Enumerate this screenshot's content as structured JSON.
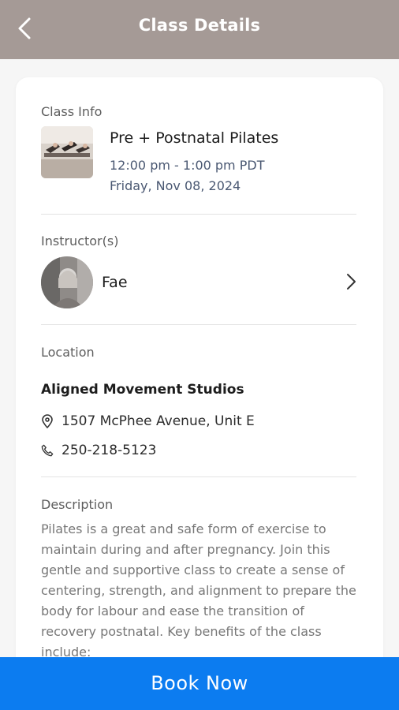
{
  "header": {
    "title": "Class Details"
  },
  "class_info": {
    "section_label": "Class Info",
    "name": "Pre + Postnatal Pilates",
    "time": "12:00 pm - 1:00 pm PDT",
    "date": "Friday, Nov 08, 2024"
  },
  "instructor": {
    "section_label": "Instructor(s)",
    "name": "Fae"
  },
  "location": {
    "section_label": "Location",
    "name": "Aligned Movement Studios",
    "address": "1507 McPhee Avenue, Unit E",
    "phone": "250-218-5123"
  },
  "description": {
    "section_label": "Description",
    "text": "Pilates is a great and safe form of exercise to maintain during and after pregnancy. Join this gentle and supportive class to create a sense of centering, strength, and alignment to prepare the body for labour and ease the transition of recovery postnatal. Key benefits of the class include:"
  },
  "footer": {
    "book_label": "Book Now"
  },
  "icons": {
    "back": "chevron-left-icon",
    "chevron": "chevron-right-icon",
    "location": "map-pin-icon",
    "phone": "phone-icon"
  },
  "colors": {
    "header_bg": "#a59a96",
    "book_button": "#0c7cf0",
    "time_text": "#4a5872"
  }
}
